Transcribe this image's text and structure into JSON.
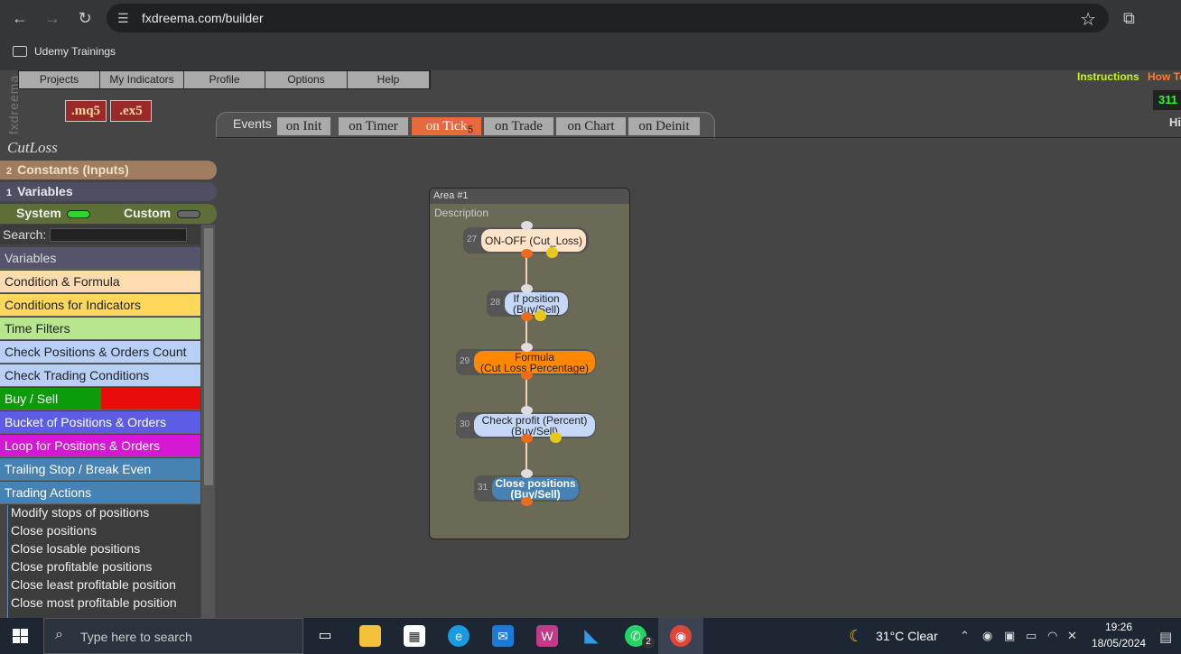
{
  "browser": {
    "url": "fxdreema.com/builder",
    "bookmark": "Udemy Trainings"
  },
  "app": {
    "logo_text": "fxdreema",
    "menu": [
      "Projects",
      "My Indicators",
      "Profile",
      "Options",
      "Help"
    ],
    "instructions": "Instructions",
    "how_to": "How To",
    "counter": "311",
    "hi": "Hi",
    "downloads": [
      ".mq5",
      ".ex5"
    ]
  },
  "events": {
    "label": "Events",
    "tabs": [
      "on Init",
      "on Timer",
      "on Tick",
      "on Trade",
      "on Chart",
      "on Deinit"
    ],
    "active": "on Tick",
    "active_badge": "5"
  },
  "sidebar": {
    "project_title": "CutLoss",
    "constants": {
      "count": "2",
      "label": "Constants (Inputs)"
    },
    "variables": {
      "count": "1",
      "label": "Variables"
    },
    "system_label": "System",
    "custom_label": "Custom",
    "system_on": true,
    "custom_on": false,
    "search_label": "Search:",
    "categories": [
      {
        "label": "Variables",
        "color": "#54546c",
        "text_color": "#ddd"
      },
      {
        "label": "Condition & Formula",
        "color": "#ffdcb0",
        "text_color": "#222"
      },
      {
        "label": "Conditions for Indicators",
        "color": "#ffd85a",
        "text_color": "#222"
      },
      {
        "label": "Time Filters",
        "color": "#b7e68e",
        "text_color": "#222"
      },
      {
        "label": "Check Positions & Orders Count",
        "color": "#b8d0f8",
        "text_color": "#222"
      },
      {
        "label": "Check Trading Conditions",
        "color": "#b8d0f8",
        "text_color": "#222"
      },
      {
        "label": "Buy / Sell",
        "color": "#0a9c0a",
        "text_color": "#fff"
      },
      {
        "label": "Bucket of Positions & Orders",
        "color": "#5c5ce6",
        "text_color": "#fff"
      },
      {
        "label": "Loop for Positions & Orders",
        "color": "#d418d4",
        "text_color": "#fff"
      },
      {
        "label": "Trailing Stop / Break Even",
        "color": "#4682b4",
        "text_color": "#fff"
      },
      {
        "label": "Trading Actions",
        "color": "#4682b4",
        "text_color": "#fff"
      }
    ],
    "trading_actions": [
      "Modify stops of positions",
      "Close positions",
      "Close losable positions",
      "Close profitable positions",
      "Close least profitable position",
      "Close most profitable position"
    ]
  },
  "area": {
    "title": "Area #1",
    "description": "Description",
    "blocks": [
      {
        "num": "27",
        "line1": "ON-OFF (Cut_Loss)",
        "line2": "",
        "color": "#ffe3c8",
        "text_color": "#222"
      },
      {
        "num": "28",
        "line1": "If position",
        "line2": "(Buy/Sell)",
        "color": "#c6d8f8",
        "text_color": "#222"
      },
      {
        "num": "29",
        "line1": "Formula",
        "line2": "(Cut Loss Percentage)",
        "color": "#ff8800",
        "text_color": "#222"
      },
      {
        "num": "30",
        "line1": "Check profit (Percent)",
        "line2": "(Buy/Sell)",
        "color": "#c6d8f8",
        "text_color": "#222"
      },
      {
        "num": "31",
        "line1": "Close positions",
        "line2": "(Buy/Sell)",
        "color": "#4682b4",
        "text_color": "#fff"
      }
    ]
  },
  "taskbar": {
    "search_placeholder": "Type here to search",
    "whatsapp_badge": "2",
    "weather": "31°C  Clear",
    "time": "19:26",
    "date": "18/05/2024"
  }
}
